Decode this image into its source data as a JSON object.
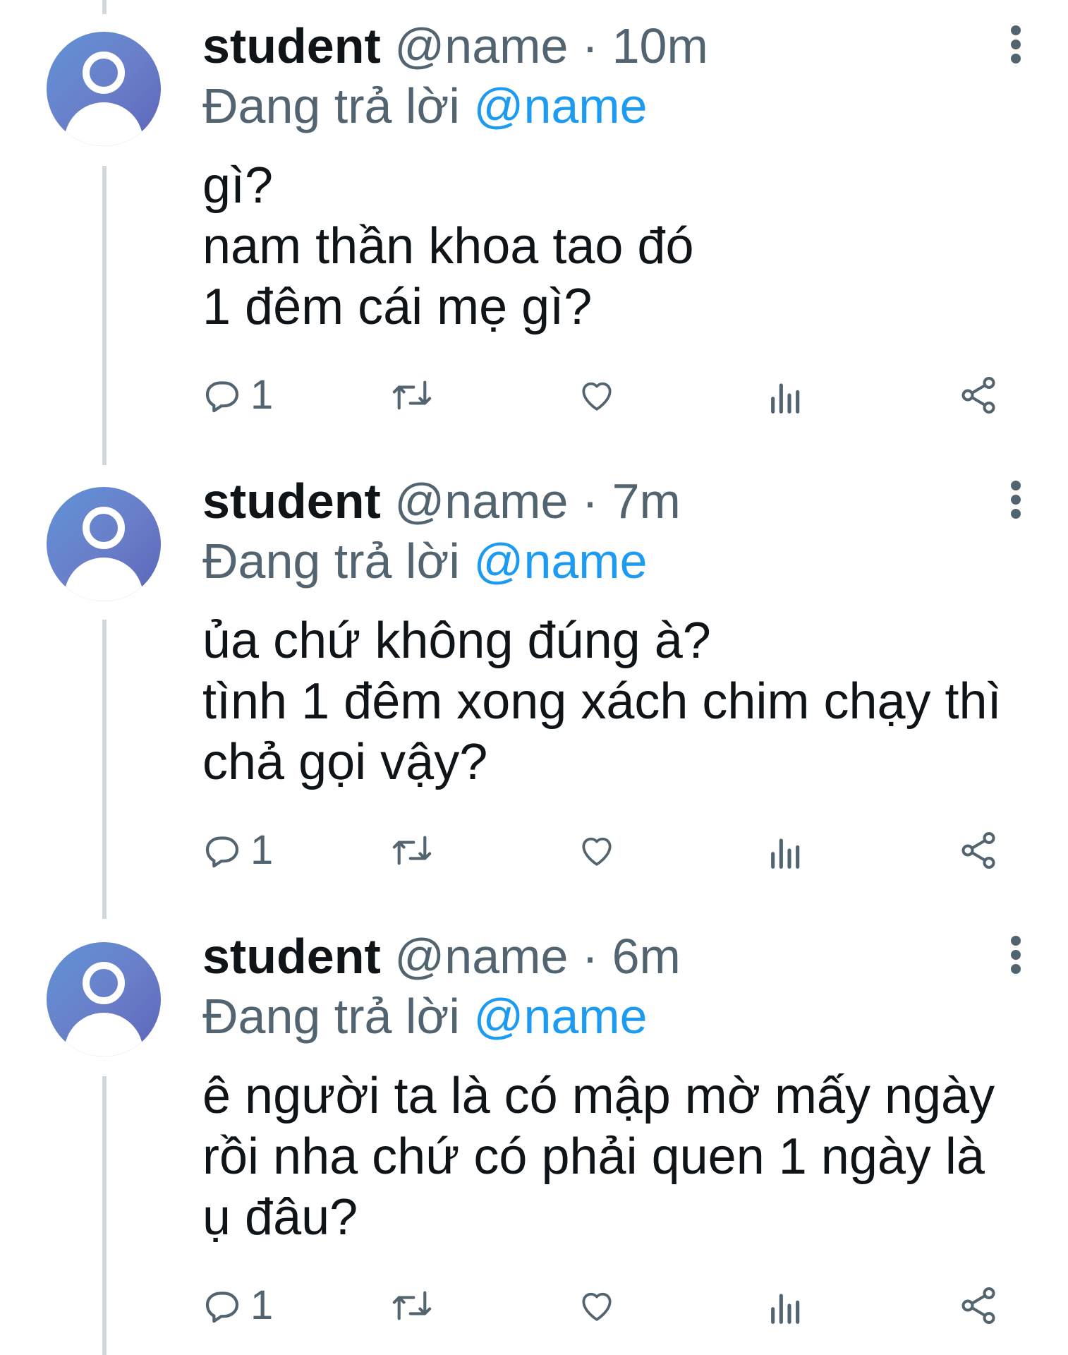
{
  "tweets": [
    {
      "name": "student",
      "handle": "@name",
      "separator": "·",
      "time": "10m",
      "reply_prefix": "Đang trả lời",
      "reply_mention": "@name",
      "text": "gì?\nnam thần khoa tao đó\n1 đêm cái mẹ gì?",
      "reply_count": "1"
    },
    {
      "name": "student",
      "handle": "@name",
      "separator": "·",
      "time": "7m",
      "reply_prefix": "Đang trả lời",
      "reply_mention": "@name",
      "text": "ủa chứ không đúng à?\ntình 1 đêm xong xách chim chạy thì\nchả gọi vậy?",
      "reply_count": "1"
    },
    {
      "name": "student",
      "handle": "@name",
      "separator": "·",
      "time": "6m",
      "reply_prefix": "Đang trả lời",
      "reply_mention": "@name",
      "text": "ê người ta là có mập mờ mấy ngày\nrồi nha chứ có phải quen 1 ngày là\nụ đâu?",
      "reply_count": "1"
    }
  ],
  "icons": {
    "avatar": "default-user-avatar",
    "more": "more-vertical-icon",
    "reply": "reply-bubble-icon",
    "retweet": "retweet-icon",
    "like": "heart-icon",
    "views": "bar-chart-icon",
    "share": "share-icon"
  },
  "colors": {
    "text": "#0f1419",
    "secondary": "#536471",
    "mention": "#1d9bf0",
    "thread_line": "#cfd9de",
    "avatar_gradient_start": "#5f93d6",
    "avatar_gradient_end": "#5c65b8"
  }
}
